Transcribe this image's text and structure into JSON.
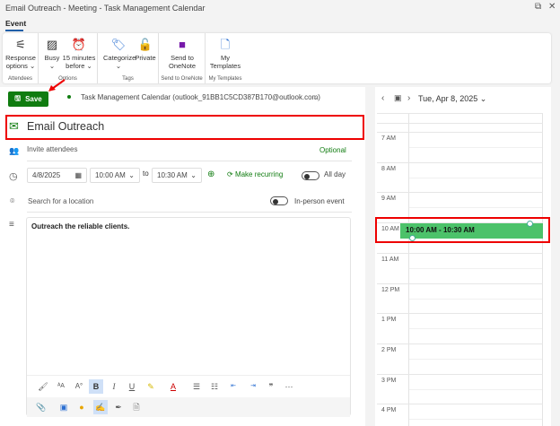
{
  "window": {
    "title": "Email Outreach - Meeting - Task Management Calendar"
  },
  "tabs": [
    {
      "label": "Event"
    }
  ],
  "ribbon": {
    "groups": [
      {
        "label": "Attendees",
        "buttons": [
          {
            "label": "Response options",
            "icon": "sliders-icon"
          }
        ]
      },
      {
        "label": "Options",
        "buttons": [
          {
            "label": "Busy",
            "icon": "busy-icon"
          },
          {
            "label": "15 minutes before",
            "icon": "alarm-icon"
          }
        ]
      },
      {
        "label": "Tags",
        "buttons": [
          {
            "label": "Categorize",
            "icon": "tag-icon"
          },
          {
            "label": "Private",
            "icon": "lock-icon"
          }
        ]
      },
      {
        "label": "Send to OneNote",
        "buttons": [
          {
            "label": "Send to OneNote",
            "icon": "onenote-icon"
          }
        ]
      },
      {
        "label": "My Templates",
        "buttons": [
          {
            "label": "My Templates",
            "icon": "template-icon"
          }
        ]
      }
    ]
  },
  "form": {
    "save_label": "Save",
    "calendar": "Task Management Calendar (outlook_91BB1C5CD387B170@outlook.com)",
    "title": "Email Outreach",
    "attendees_placeholder": "Invite attendees",
    "optional_label": "Optional",
    "date": "4/8/2025",
    "start_time": "10:00 AM",
    "to_label": "to",
    "end_time": "10:30 AM",
    "recurring_label": "Make recurring",
    "allday_label": "All day",
    "location_placeholder": "Search for a location",
    "inperson_label": "In-person event",
    "body": "Outreach the reliable clients."
  },
  "calendar_pane": {
    "date": "Tue, Apr 8, 2025",
    "hours": [
      "7 AM",
      "8 AM",
      "9 AM",
      "10 AM",
      "11 AM",
      "12 PM",
      "1 PM",
      "2 PM",
      "3 PM",
      "4 PM"
    ],
    "event_time": "10:00 AM - 10:30 AM",
    "event_color": "#4cc26a"
  },
  "accent": "#107c10"
}
